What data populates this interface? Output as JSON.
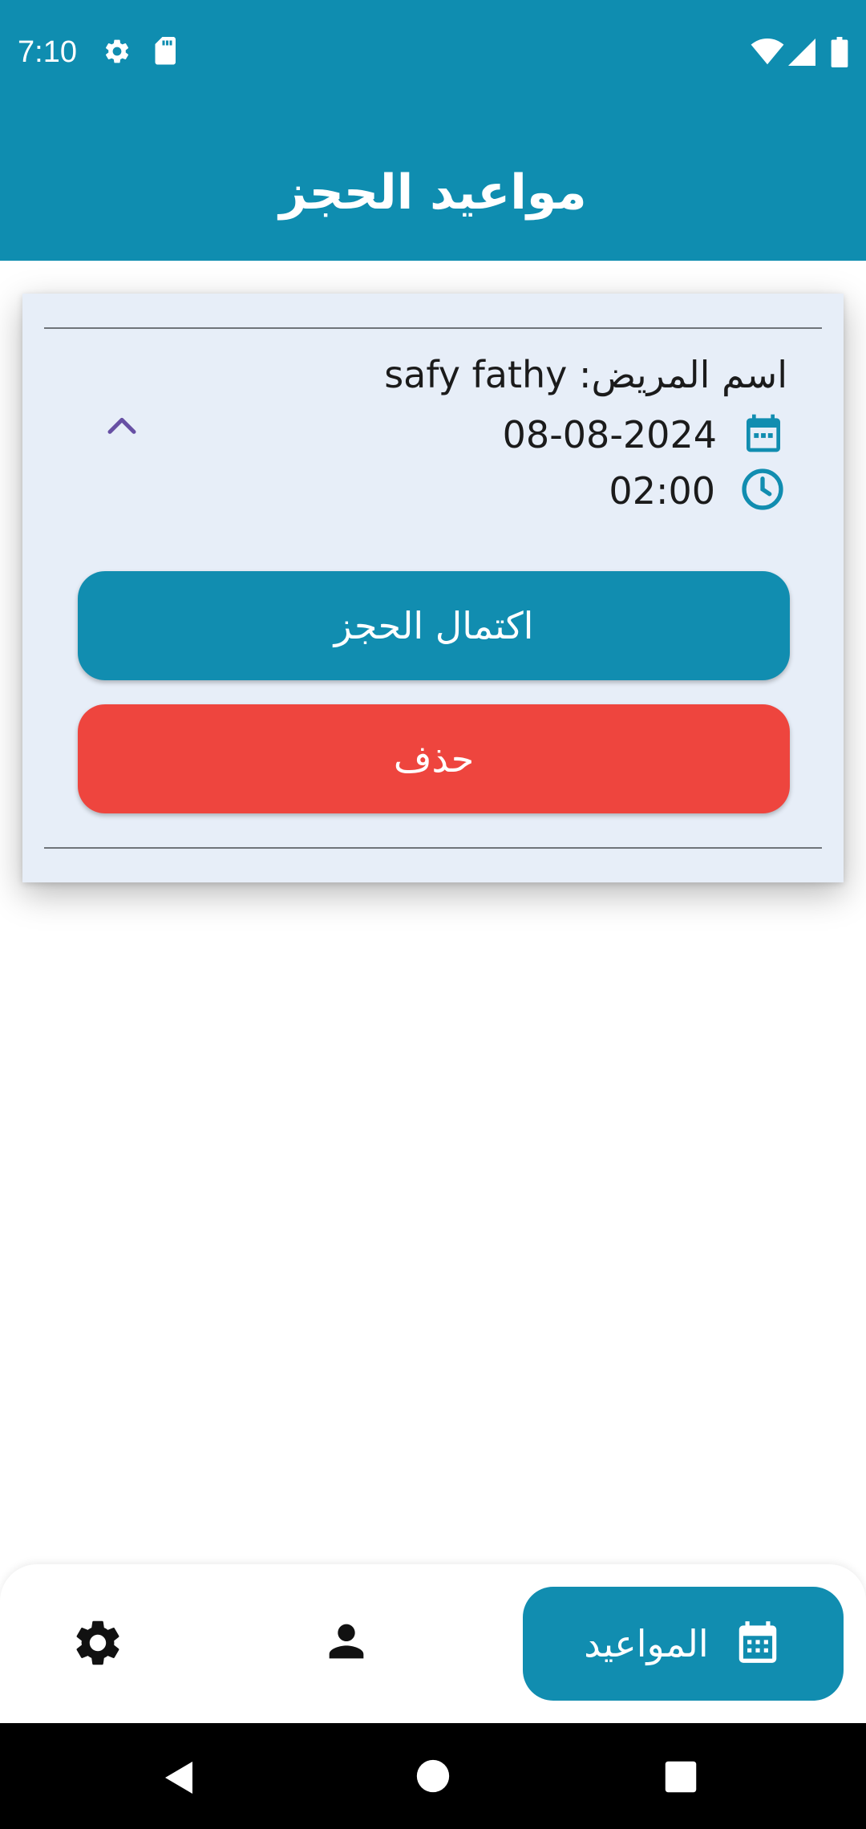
{
  "status_bar": {
    "time": "7:10",
    "icons": [
      "gear-icon",
      "sd-card-icon",
      "wifi-icon",
      "signal-icon",
      "battery-icon"
    ]
  },
  "app_bar": {
    "title": "مواعيد الحجز"
  },
  "appointment": {
    "patient_line": "اسم المريض: safy fathy",
    "date": "08-08-2024",
    "time": "02:00",
    "complete_button": "اكتمال الحجز",
    "delete_button": "حذف"
  },
  "bottom_nav": {
    "active_label": "المواعيد",
    "items": [
      "calendar-icon",
      "person-icon",
      "gear-icon"
    ]
  },
  "colors": {
    "primary": "#0f8db0",
    "card_background": "#e7eef8",
    "delete": "#ee453e",
    "collapse_chevron": "#6750a4"
  }
}
